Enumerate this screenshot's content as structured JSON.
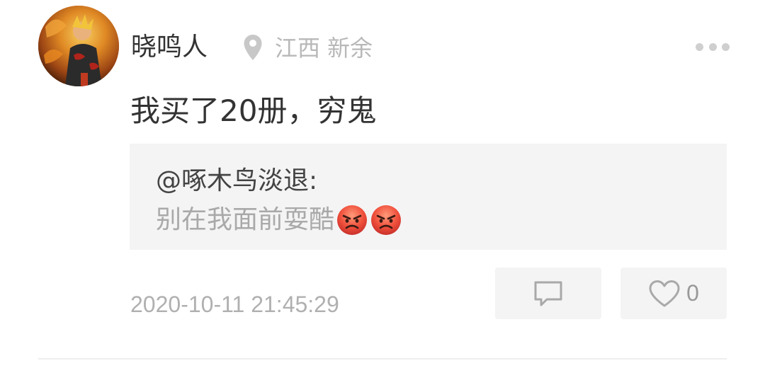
{
  "comment": {
    "username": "晓鸣人",
    "location": "江西  新余",
    "content": "我买了20册，穷鬼",
    "quote": {
      "author": "@啄木鸟淡退:",
      "text": "别在我面前耍酷",
      "emojis": [
        "angry-face",
        "angry-face"
      ]
    },
    "timestamp": "2020-10-11 21:45:29",
    "like_count": "0"
  },
  "icons": {
    "location": "location-pin-icon",
    "more": "more-dots-icon",
    "reply": "comment-bubble-icon",
    "like": "heart-icon"
  },
  "colors": {
    "username": "#333333",
    "secondary_text": "#b0b0b0",
    "quote_background": "#f4f4f4",
    "icon_gray": "#a9a9a9"
  }
}
